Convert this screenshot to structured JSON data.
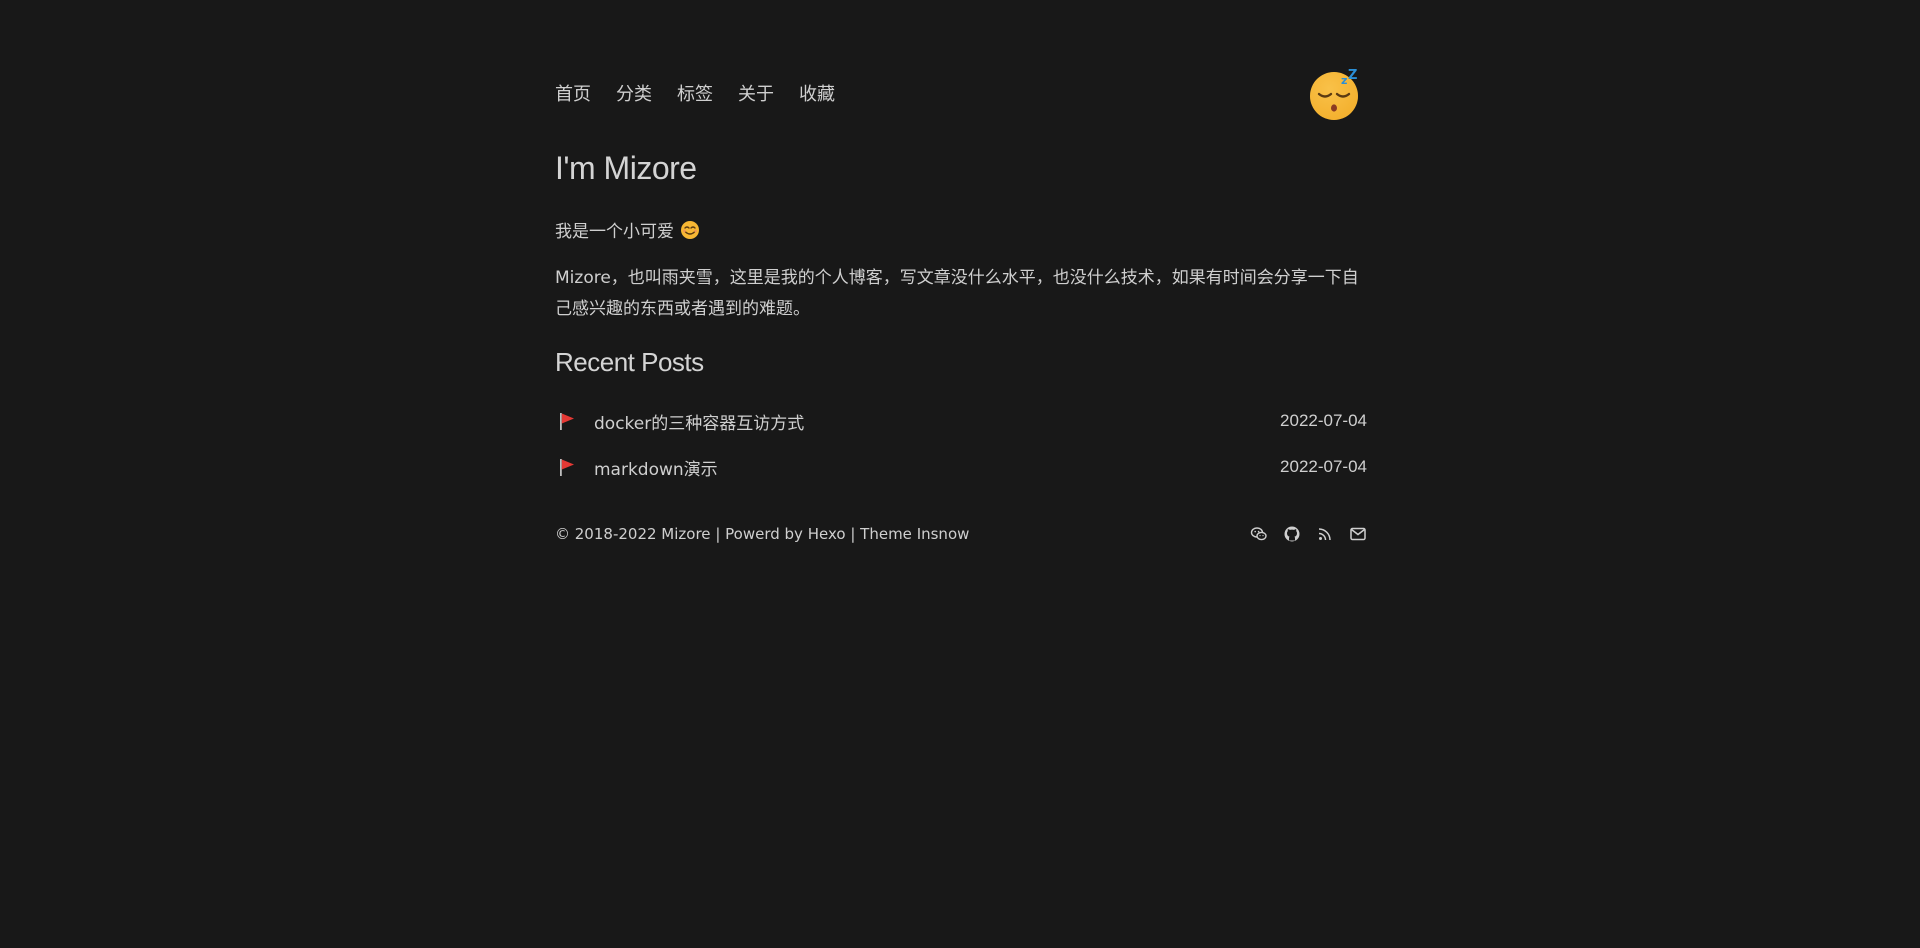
{
  "nav": {
    "items": [
      {
        "label": "首页"
      },
      {
        "label": "分类"
      },
      {
        "label": "标签"
      },
      {
        "label": "关于"
      },
      {
        "label": "收藏"
      }
    ]
  },
  "header": {
    "avatar_icon": "sleeping-face-icon"
  },
  "main": {
    "title": "I'm Mizore",
    "intro": "我是一个小可爱",
    "intro_icon": "smiling-face-icon",
    "description": "Mizore，也叫雨夹雪，这里是我的个人博客，写文章没什么水平，也没什么技术，如果有时间会分享一下自己感兴趣的东西或者遇到的难题。",
    "recent_title": "Recent Posts",
    "posts": [
      {
        "title": "docker的三种容器互访方式",
        "date": "2022-07-04",
        "icon": "red-flag-icon"
      },
      {
        "title": "markdown演示",
        "date": "2022-07-04",
        "icon": "red-flag-icon"
      }
    ]
  },
  "footer": {
    "copyright": "© 2018-2022 Mizore",
    "sep1": "|",
    "powered_prefix": "Powerd by ",
    "powered_link": "Hexo",
    "sep2": "|",
    "theme_prefix": "Theme ",
    "theme_link": "Insnow",
    "icons": [
      "wechat-icon",
      "github-icon",
      "rss-icon",
      "mail-icon"
    ]
  },
  "colors": {
    "background": "#181818",
    "text": "#cfcfcf",
    "flag": "#e53935",
    "emoji": "#f7b733"
  }
}
